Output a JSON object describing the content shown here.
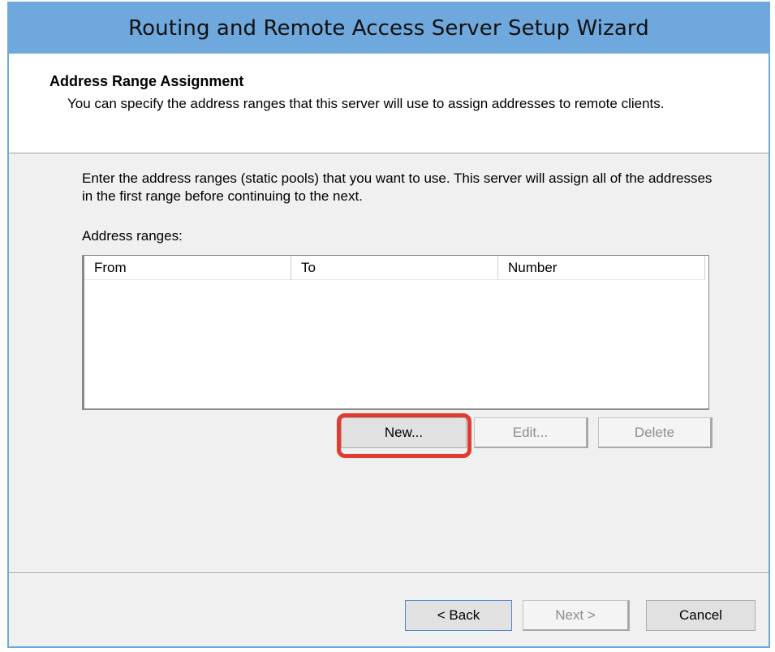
{
  "window": {
    "title": "Routing and Remote Access Server Setup Wizard"
  },
  "header": {
    "title": "Address Range Assignment",
    "description": "You can specify the address ranges that this server will use to assign addresses to remote clients."
  },
  "body": {
    "instructions": "Enter the address ranges (static pools) that you want to use. This server will assign all of the addresses in the first range before continuing to the next.",
    "ranges_label": "Address ranges:"
  },
  "address_table": {
    "columns": [
      "From",
      "To",
      "Number"
    ],
    "rows": []
  },
  "list_buttons": {
    "new_label": "New...",
    "edit_label": "Edit...",
    "delete_label": "Delete"
  },
  "nav_buttons": {
    "back_label": "< Back",
    "next_label": "Next >",
    "cancel_label": "Cancel"
  },
  "colors": {
    "titlebar": "#6fa8dc",
    "highlight": "#e03c31"
  }
}
